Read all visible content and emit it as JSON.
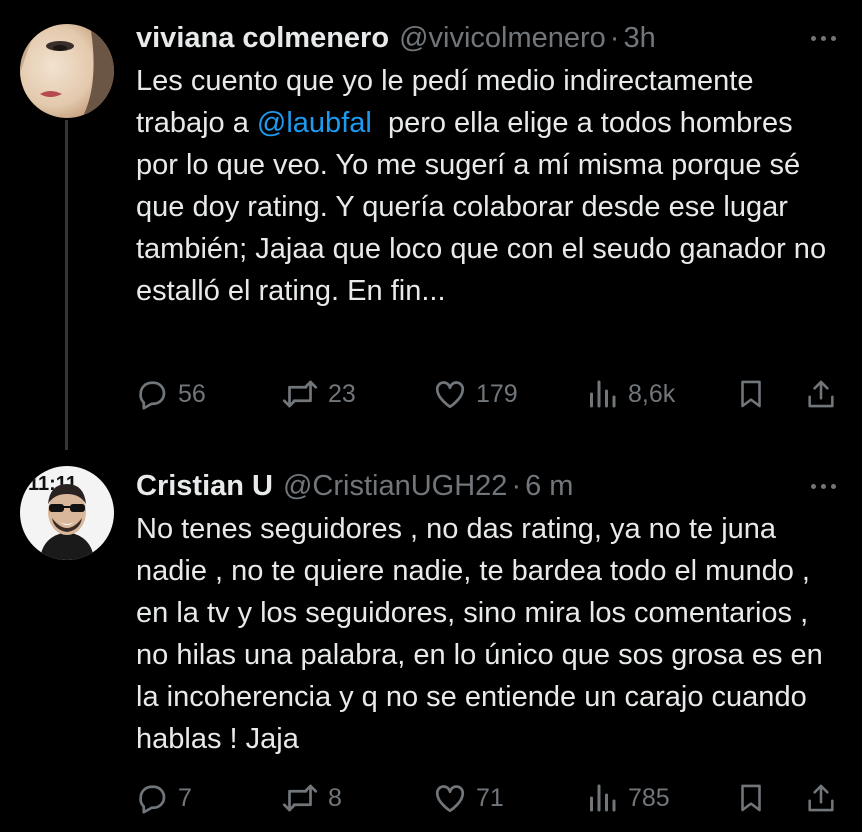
{
  "tweets": [
    {
      "name": "viviana colmenero",
      "handle": "@vivicolmenero",
      "separator": "·",
      "time": "3h",
      "text_before": "Les cuento que yo le pedí medio indirectamente trabajo a ",
      "mention": "@laubfal",
      "text_after": "  pero ella elige a todos hombres por lo que veo. Yo me sugerí a mí misma porque sé que doy rating. Y quería colaborar desde ese lugar también; Jajaa que loco que con el seudo ganador no estalló el rating. En fin...",
      "replies": "56",
      "retweets": "23",
      "likes": "179",
      "views": "8,6k"
    },
    {
      "name": "Cristian U",
      "handle": "@CristianUGH22",
      "separator": "·",
      "time": "6 m",
      "text": "No tenes seguidores , no das rating, ya no te juna nadie , no te quiere nadie, te bardea todo el mundo , en la tv y los seguidores, sino mira los comentarios , no hilas una palabra, en lo único que sos grosa es en la incoherencia y q no se entiende un carajo cuando hablas ! Jaja",
      "replies": "7",
      "retweets": "8",
      "likes": "71",
      "views": "785"
    }
  ],
  "icons": [
    "reply-icon",
    "retweet-icon",
    "like-icon",
    "views-icon",
    "bookmark-icon",
    "share-icon",
    "more-icon"
  ],
  "colors": {
    "background": "#000000",
    "text": "#e7e9ea",
    "muted": "#71767b",
    "link": "#1d9bf0"
  }
}
